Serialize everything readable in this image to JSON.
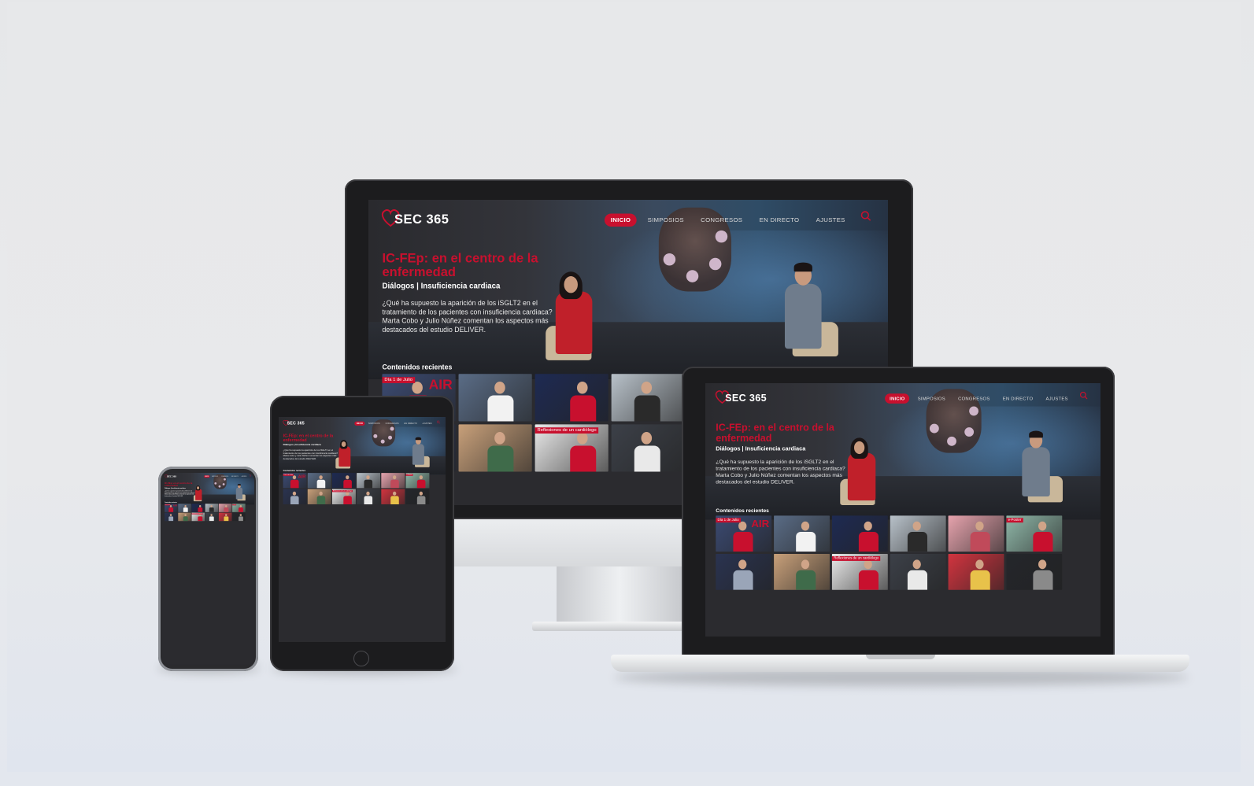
{
  "site": {
    "logo": "SEC 365",
    "nav": [
      "INICIO",
      "SIMPOSIOS",
      "CONGRESOS",
      "EN DIRECTO",
      "AJUSTES"
    ],
    "hero": {
      "title": "IC-FEp: en el centro de la enfermedad",
      "subtitle": "Diálogos | Insuficiencia cardiaca",
      "description": "¿Qué ha supuesto la aparición de los iSGLT2 en el tratamiento de los pacientes con insuficiencia cardiaca? Marta Cobo y Julio Núñez comentan los aspectos más destacados del estudio DELIVER."
    },
    "recent_heading": "Contenidos recientes",
    "thumb_tags": [
      "Día 1 de Julio",
      "",
      "",
      "",
      "",
      "e-Poster",
      "",
      "",
      "Reflexiones de un cardiólogo",
      "",
      "",
      ""
    ],
    "thumbs": [
      {
        "bg": "#3b4a72",
        "accent": "#c8102e",
        "text": "AIR"
      },
      {
        "bg": "#5a6c86",
        "accent": "#f2f2f2",
        "text": ""
      },
      {
        "bg": "#1e2a52",
        "accent": "#c8102e",
        "text": ""
      },
      {
        "bg": "#b8c1c9",
        "accent": "#2a2a2a",
        "text": ""
      },
      {
        "bg": "#e6a3ad",
        "accent": "#c04a5a",
        "text": ""
      },
      {
        "bg": "#8fb7a8",
        "accent": "#c8102e",
        "text": ""
      },
      {
        "bg": "#2a3350",
        "accent": "#9aa5b8",
        "text": ""
      },
      {
        "bg": "#c8a07a",
        "accent": "#3f6b4a",
        "text": ""
      },
      {
        "bg": "#e9e9e9",
        "accent": "#c8102e",
        "text": ""
      },
      {
        "bg": "#3c4048",
        "accent": "#e9e9e9",
        "text": ""
      },
      {
        "bg": "#d2343f",
        "accent": "#e8c24a",
        "text": ""
      },
      {
        "bg": "#24262b",
        "accent": "#8a8a8a",
        "text": ""
      }
    ]
  },
  "colors": {
    "accent": "#c8102e",
    "background": "#2b2b2f"
  }
}
